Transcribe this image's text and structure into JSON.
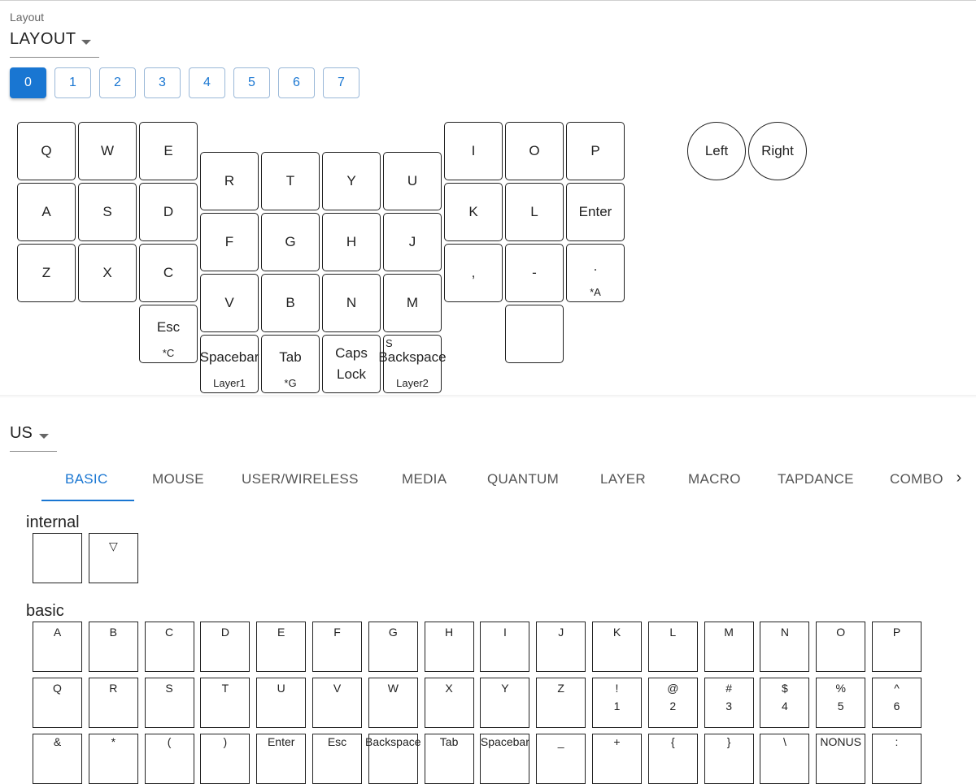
{
  "layout_label": "Layout",
  "layout_value": "LAYOUT",
  "layers": [
    "0",
    "1",
    "2",
    "3",
    "4",
    "5",
    "6",
    "7"
  ],
  "keymap": {
    "keys": [
      "Q",
      "W",
      "E",
      "R",
      "T",
      "Y",
      "U",
      "I",
      "O",
      "P",
      "A",
      "S",
      "D",
      "F",
      "G",
      "H",
      "J",
      "K",
      "L",
      "Enter",
      "Z",
      "X",
      "C",
      "V",
      "B",
      "N",
      "M",
      ",",
      "-",
      ".",
      "Esc",
      "Spacebar",
      "Tab",
      "Caps Lock",
      "Backspace",
      ""
    ],
    "subs": {
      "dot": "*A",
      "esc": "*C",
      "spacebar": "Layer1",
      "tab": "*G",
      "backspace": "Layer2"
    },
    "backspace_corner": "S",
    "encoders": [
      "Left",
      "Right"
    ]
  },
  "keyboard_language": "US",
  "tabs": [
    "BASIC",
    "MOUSE",
    "USER/WIRELESS",
    "MEDIA",
    "QUANTUM",
    "LAYER",
    "MACRO",
    "TAPDANCE",
    "COMBO"
  ],
  "tab_scroll_icon": "chevron-right-icon",
  "sections": {
    "internal": "internal",
    "basic": "basic"
  },
  "internal_keys": [
    "",
    "▽"
  ],
  "basic_rows": [
    [
      [
        "A",
        ""
      ],
      [
        "B",
        ""
      ],
      [
        "C",
        ""
      ],
      [
        "D",
        ""
      ],
      [
        "E",
        ""
      ],
      [
        "F",
        ""
      ],
      [
        "G",
        ""
      ],
      [
        "H",
        ""
      ],
      [
        "I",
        ""
      ],
      [
        "J",
        ""
      ],
      [
        "K",
        ""
      ],
      [
        "L",
        ""
      ],
      [
        "M",
        ""
      ],
      [
        "N",
        ""
      ],
      [
        "O",
        ""
      ],
      [
        "P",
        ""
      ]
    ],
    [
      [
        "Q",
        ""
      ],
      [
        "R",
        ""
      ],
      [
        "S",
        ""
      ],
      [
        "T",
        ""
      ],
      [
        "U",
        ""
      ],
      [
        "V",
        ""
      ],
      [
        "W",
        ""
      ],
      [
        "X",
        ""
      ],
      [
        "Y",
        ""
      ],
      [
        "Z",
        ""
      ],
      [
        "!",
        "1"
      ],
      [
        "@",
        "2"
      ],
      [
        "#",
        "3"
      ],
      [
        "$",
        "4"
      ],
      [
        "%",
        "5"
      ],
      [
        "^",
        "6"
      ]
    ],
    [
      [
        "&",
        ""
      ],
      [
        "*",
        ""
      ],
      [
        "(",
        ""
      ],
      [
        ")",
        ""
      ],
      [
        "Enter",
        ""
      ],
      [
        "Esc",
        ""
      ],
      [
        "Backspace",
        ""
      ],
      [
        "Tab",
        ""
      ],
      [
        "Spacebar",
        ""
      ],
      [
        "_",
        ""
      ],
      [
        "+",
        ""
      ],
      [
        "{",
        ""
      ],
      [
        "}",
        ""
      ],
      [
        "\\",
        ""
      ],
      [
        "NONUS",
        ""
      ],
      [
        ":",
        ""
      ]
    ]
  ],
  "colors": {
    "accent": "#1976d2",
    "border": "#222222"
  }
}
